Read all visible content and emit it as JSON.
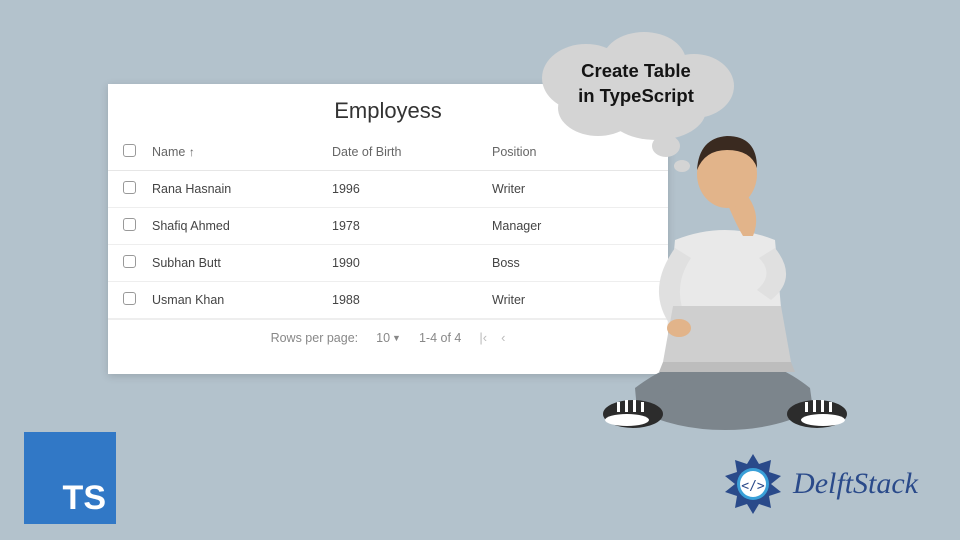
{
  "bubble": {
    "line1": "Create Table",
    "line2": "in TypeScript"
  },
  "card": {
    "title": "Employess",
    "columns": {
      "name": "Name",
      "dob": "Date of Birth",
      "position": "Position",
      "sort_indicator": "↑"
    },
    "rows": [
      {
        "name": "Rana Hasnain",
        "dob": "1996",
        "position": "Writer"
      },
      {
        "name": "Shafiq Ahmed",
        "dob": "1978",
        "position": "Manager"
      },
      {
        "name": "Subhan Butt",
        "dob": "1990",
        "position": "Boss"
      },
      {
        "name": "Usman Khan",
        "dob": "1988",
        "position": "Writer"
      }
    ],
    "pager": {
      "rows_per_page_label": "Rows per page:",
      "rows_per_page_value": "10",
      "range": "1-4 of 4"
    }
  },
  "ts_label": "TS",
  "delft_label": "DelftStack"
}
